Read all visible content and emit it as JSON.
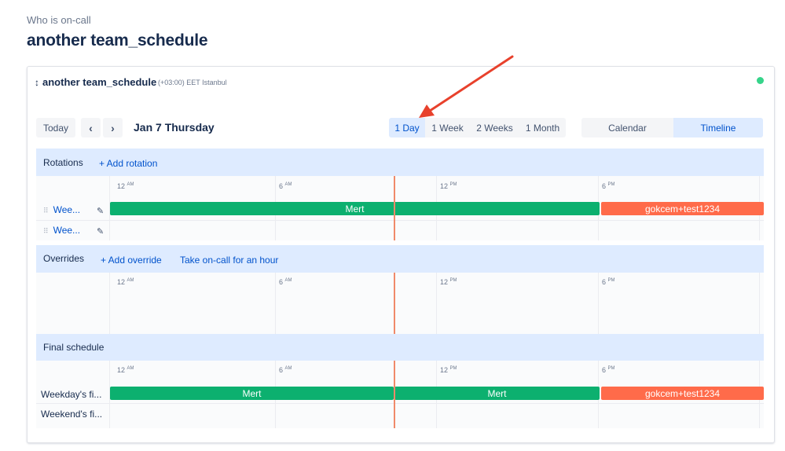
{
  "page": {
    "subtitle": "Who is on-call",
    "title": "another team_schedule"
  },
  "schedule": {
    "name": "another team_schedule",
    "timezone": "(+03:00) EET Istanbul",
    "status_color": "#36d48a"
  },
  "toolbar": {
    "today_label": "Today",
    "prev_icon": "‹",
    "next_icon": "›",
    "date_label": "Jan 7 Thursday",
    "ranges": [
      "1 Day",
      "1 Week",
      "2 Weeks",
      "1 Month"
    ],
    "active_range": "1 Day",
    "views": [
      "Calendar",
      "Timeline"
    ],
    "active_view": "Timeline"
  },
  "ticks": {
    "t0": "12",
    "t0_suffix": "AM",
    "t1": "6",
    "t1_suffix": "AM",
    "t2": "12",
    "t2_suffix": "PM",
    "t3": "6",
    "t3_suffix": "PM"
  },
  "rotations": {
    "label": "Rotations",
    "add_label": "+ Add rotation",
    "rows": [
      {
        "name": "Wee...",
        "bars": [
          {
            "label": "Mert"
          },
          {
            "label": "gokcem+test1234"
          }
        ]
      },
      {
        "name": "Wee...",
        "bars": []
      }
    ]
  },
  "overrides": {
    "label": "Overrides",
    "add_label": "+ Add override",
    "take_label": "Take on-call for an hour"
  },
  "final": {
    "label": "Final schedule",
    "rows": [
      {
        "name": "Weekday's fi...",
        "bars": [
          {
            "label": "Mert"
          },
          {
            "label": "Mert"
          },
          {
            "label": "gokcem+test1234"
          }
        ]
      },
      {
        "name": "Weekend's fi...",
        "bars": []
      }
    ]
  },
  "colors": {
    "green": "#0cb06f",
    "orange": "#ff6b4a",
    "accent": "#0052cc",
    "annotation_arrow": "#e8412c"
  }
}
